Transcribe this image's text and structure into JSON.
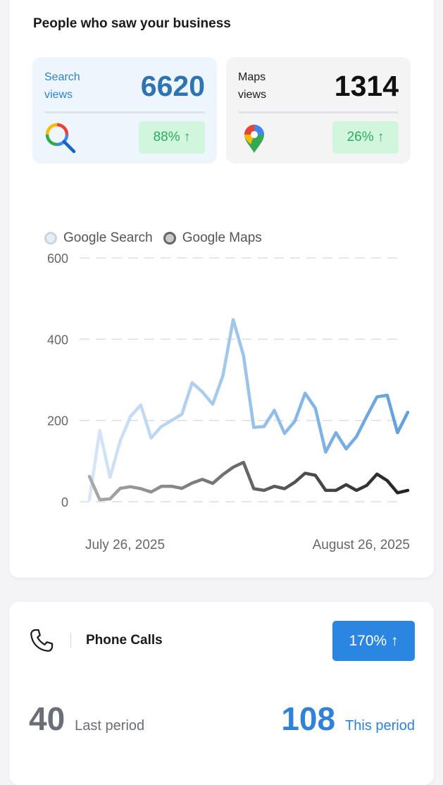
{
  "overview": {
    "title": "People who saw your business",
    "search": {
      "label": "Search views",
      "value": "6620",
      "change": "88% ↑",
      "icon": "google-search-icon"
    },
    "maps": {
      "label": "Maps views",
      "value": "1314",
      "change": "26% ↑",
      "icon": "google-maps-pin-icon"
    }
  },
  "chart_data": {
    "type": "line",
    "legend": [
      "Google Search",
      "Google Maps"
    ],
    "legend_position": "top-left",
    "ylim": [
      0,
      600
    ],
    "yticks": [
      "0",
      "200",
      "400",
      "600"
    ],
    "x_labels": [
      "July 26, 2025",
      "August 26, 2025"
    ],
    "x_start": "2025-07-26",
    "x_end": "2025-08-26",
    "grid": "horizontal dashed",
    "series": [
      {
        "name": "Google Search",
        "color_start": "#d6e6f7",
        "color_end": "#5f9fdc",
        "values": [
          5,
          175,
          60,
          150,
          210,
          238,
          157,
          185,
          200,
          215,
          293,
          270,
          240,
          310,
          448,
          360,
          183,
          185,
          225,
          168,
          198,
          267,
          230,
          122,
          170,
          130,
          160,
          210,
          258,
          262,
          170,
          220
        ]
      },
      {
        "name": "Google Maps",
        "color_start": "#aaaaaa",
        "color_end": "#222222",
        "values": [
          62,
          5,
          7,
          33,
          37,
          32,
          24,
          38,
          38,
          33,
          46,
          55,
          45,
          67,
          85,
          97,
          32,
          28,
          38,
          32,
          48,
          70,
          65,
          28,
          28,
          42,
          28,
          40,
          68,
          52,
          22,
          28
        ]
      }
    ]
  },
  "calls": {
    "title": "Phone Calls",
    "change": "170% ↑",
    "last_value": "40",
    "last_label": "Last period",
    "this_value": "108",
    "this_label": "This period"
  }
}
